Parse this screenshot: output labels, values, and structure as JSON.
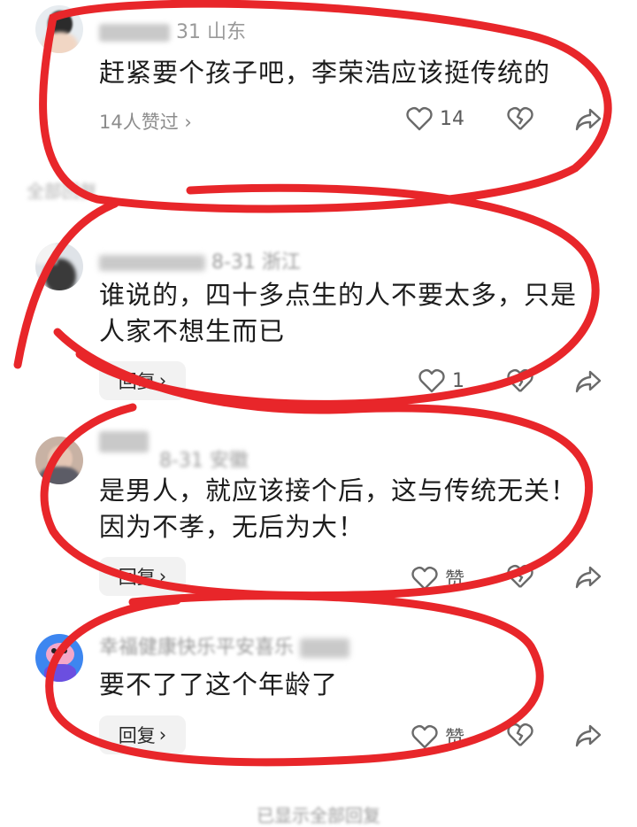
{
  "comments": [
    {
      "meta": "31  山东",
      "text": "赶紧要个孩子吧，李荣浩应该挺传统的",
      "likes_link": "14人赞过 ›",
      "like_count": "14"
    },
    {
      "meta": "8-31  浙江",
      "text": "谁说的，四十多点生的人不要太多，只是人家不想生而已",
      "reply_label": "回复",
      "like_count": "1"
    },
    {
      "meta": "8-31  安徽",
      "text": "是男人，就应该接个后，这与传统无关！因为不孝，无后为大！",
      "reply_label": "回复",
      "like_count": "赞"
    },
    {
      "meta": "幸福健康快乐平安喜乐",
      "text": "要不了了这个年龄了",
      "reply_label": "回复",
      "like_count": "赞"
    }
  ],
  "section_label": "全部回复",
  "footer_text": "已显示全部回复",
  "colors": {
    "annotation": "#e8262a",
    "icon": "#6a6a6a"
  }
}
